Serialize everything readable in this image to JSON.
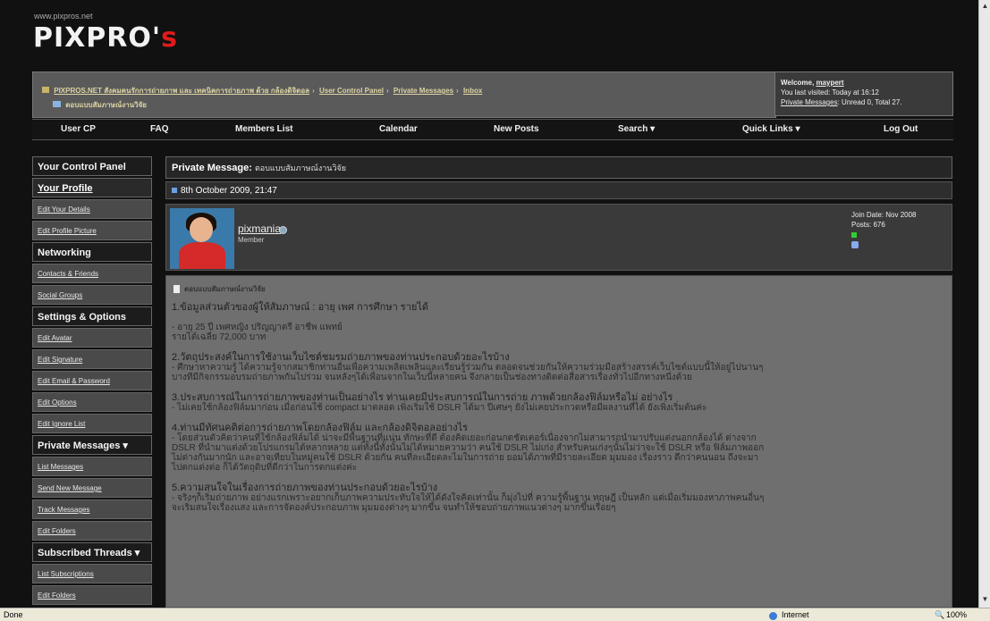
{
  "header": {
    "site_url": "www.pixpros.net",
    "logo_main": "PIXPRO'",
    "logo_s": "s"
  },
  "breadcrumb": {
    "items": [
      "PIXPROS.NET สังคมคนรักการถ่ายภาพ และ เทคนิคการถ่ายภาพ ด้วย กล้องดิจิตอล",
      "User Control Panel",
      "Private Messages",
      "Inbox"
    ],
    "current": "ตอบแบบสัมภาษณ์งานวิจัย"
  },
  "welcome": {
    "greeting": "Welcome,",
    "username": "maypert",
    "last_visited": "You last visited: Today at 16:12",
    "pm_link": "Private Messages",
    "pm_status": ": Unread 0, Total 27."
  },
  "menu": [
    "User CP",
    "FAQ",
    "Members List",
    "Calendar",
    "New Posts",
    "Search ▾",
    "Quick Links ▾",
    "Log Out"
  ],
  "sidebar": {
    "title": "Your Control Panel",
    "sections": [
      {
        "kind": "bold",
        "label": "Your Profile"
      },
      {
        "kind": "link",
        "label": "Edit Your Details"
      },
      {
        "kind": "link",
        "label": "Edit Profile Picture"
      },
      {
        "kind": "head",
        "label": "Networking"
      },
      {
        "kind": "link",
        "label": "Contacts & Friends"
      },
      {
        "kind": "link",
        "label": "Social Groups"
      },
      {
        "kind": "head",
        "label": "Settings & Options"
      },
      {
        "kind": "link",
        "label": "Edit Avatar"
      },
      {
        "kind": "link",
        "label": "Edit Signature"
      },
      {
        "kind": "link",
        "label": "Edit Email & Password"
      },
      {
        "kind": "link",
        "label": "Edit Options"
      },
      {
        "kind": "link",
        "label": "Edit Ignore List"
      },
      {
        "kind": "head",
        "label": "Private Messages ▾"
      },
      {
        "kind": "link",
        "label": "List Messages"
      },
      {
        "kind": "link",
        "label": "Send New Message"
      },
      {
        "kind": "link",
        "label": "Track Messages"
      },
      {
        "kind": "link",
        "label": "Edit Folders"
      },
      {
        "kind": "head",
        "label": "Subscribed Threads ▾"
      },
      {
        "kind": "link",
        "label": "List Subscriptions"
      },
      {
        "kind": "link",
        "label": "Edit Folders"
      }
    ]
  },
  "pm": {
    "title_label": "Private Message:",
    "title_subject": "ตอบแบบสัมภาษณ์งานวิจัย",
    "date": "8th October 2009, 21:47",
    "user": {
      "name": "pixmania",
      "role": "Member",
      "join_date": "Join Date: Nov 2008",
      "posts": "Posts: 676"
    },
    "message_title": "ตอบแบบสัมภาษณ์งานวิจัย",
    "paragraphs": [
      {
        "q": "1.ข้อมูลส่วนตัวของผู้ให้สัมภาษณ์ : อายุ เพศ การศึกษา รายได้",
        "a": "- อายุ 25 ปี เพศหญิง ปริญญาตรี อาชีพ แพทย์\nรายได้เฉลี่ย 72,000 บาท"
      },
      {
        "q": "2.วัตถุประสงค์ในการใช้งานเว็บไซต์ชมรมถ่ายภาพของท่านประกอบด้วยอะไรบ้าง",
        "a": "- ศึกษาหาความรู้ ได้ความรู้จากสมาชิกท่านอื่นเพื่อความเพลิดเพลินและเรียนรู้ร่วมกัน ตลอดจนช่วยกันให้ความร่วมมือสร้างสรรค์เว็บไซต์แบบนี้ให้อยู่ไปนานๆ\nบางทีมีกิจกรรมอบรมถ่ายภาพกันไปร่วม จนหลังๆได้เพื่อนจากในเว็บนี้หลายคน จึงกลายเป็นช่องทางติดต่อสื่อสารเรื่องทั่วไปอีกทางหนึ่งด้วย"
      },
      {
        "q": "3.ประสบการณ์ในการถ่ายภาพของท่านเป็นอย่างไร ท่านเคยมีประสบการณ์ในการถ่าย ภาพด้วยกล้องฟิล์มหรือไม่ อย่างไร",
        "a": "- ไม่เคยใช้กล้องฟิล์มมาก่อน เมื่อก่อนใช้ compact มาตลอด เพิ่งเริ่มใช้ DSLR ได้มา ปีเศษๆ ยังไม่เคยประกวดหรือมีผลงานที่ได้ ยังเพิ่งเริ่มต้นค่ะ"
      },
      {
        "q": "4.ท่านมีทัศนคติต่อการถ่ายภาพโดยกล้องฟิล์ม และกล้องดิจิตอลอย่างไร",
        "a": "- โดยส่วนตัวคิดว่าคนที่ใช้กล้องฟิล์มได้ น่าจะมีพื้นฐานที่แน่น ทักษะที่ดี ต้องคิดเยอะก่อนกดชัตเตอร์เนื่องจากไม่สามารถนำมาปรับแต่งนอกกล้องได้ ต่างจาก\nDSLR ที่นำมาแต่งด้วยโปรแกรมได้หลากหลาย แต่ทั้งนี้ทั้งนั้นไม่ได้หมายความว่า คนใช้ DSLR ไม่เก่ง สำหรับคนเก่งๆนั้นไม่ว่าจะใช้ DSLR หรือ ฟิล์มภาพออก\nไม่ต่างกันมากนัก และอาจเทียบในหมู่คนใช้ DSLR ด้วยกัน คนที่ละเอียดละไมในการถ่าย ยอมได้ภาพที่มีรายละเอียด มุมมอง เรื่องราว ดีกว่าคนนอน ถึงจะมา\nไปตกแต่งต่อ ก็ได้วัตถุดิบที่ดีกว่าในการตกแต่งค่ะ"
      },
      {
        "q": "5.ความสนใจในเรื่องการถ่ายภาพของท่านประกอบด้วยอะไรบ้าง",
        "a": "- จริงๆก็เริ่มถ่ายภาพ อย่างแรกเพราะอยากเก็บภาพความประทับใจให้ได้ดังใจคิดเท่านั้น ก็มุ่งไปที่ ความรู้พื้นฐาน ทฤษฎี เป็นหลัก แต่เมื่อเริ่มมองหาภาพคนอื่นๆ\nจะเริ่มสนใจเรื่องแสง และการจัดองค์ประกอบภาพ มุมมองต่างๆ มากขึ้น จนทำให้ชอบถ่ายภาพแนวต่างๆ มากขึ้นเรื่อยๆ"
      }
    ]
  },
  "statusbar": {
    "left": "Done",
    "zone": "Internet",
    "zoom": "100%"
  }
}
